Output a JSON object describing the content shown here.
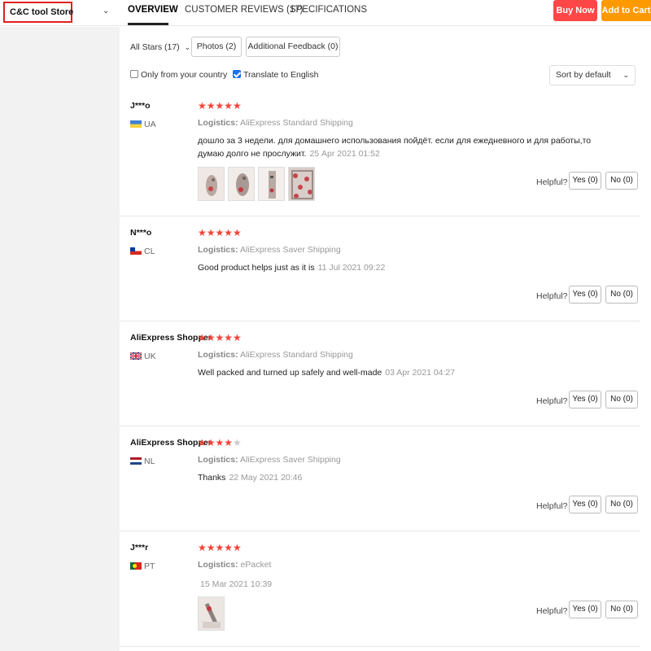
{
  "header": {
    "store_name": "C&C tool Store",
    "tabs": [
      "OVERVIEW",
      "CUSTOMER REVIEWS (17)",
      "SPECIFICATIONS"
    ],
    "buy_now": "Buy Now",
    "add_to_cart": "Add to Cart",
    "colors": {
      "buy": "#ff4747",
      "cart": "#ff9900",
      "accent": "#e02020"
    }
  },
  "filters": {
    "stars_dropdown": "All Stars (17)",
    "photos": "Photos (2)",
    "additional": "Additional Feedback (0)",
    "only_country": "Only from your country",
    "only_country_checked": false,
    "translate": "Translate to English",
    "translate_checked": true,
    "sort": "Sort by default"
  },
  "helpful_label": "Helpful?",
  "reviews": [
    {
      "name": "J***o",
      "country": "UA",
      "flag": "flag-ua-icon",
      "stars": 5,
      "logistics_label": "Logistics:",
      "logistics": "AliExpress Standard Shipping",
      "text": "дошло за 3 недели. для домашнего использования пойдёт. если для ежедневного и для работы,то думаю долго не прослужит.",
      "date": "25 Apr 2021 01:52",
      "photos": 4,
      "yes": "Yes (0)",
      "no": "No (0)"
    },
    {
      "name": "N***o",
      "country": "CL",
      "flag": "flag-cl-icon",
      "stars": 5,
      "logistics_label": "Logistics:",
      "logistics": "AliExpress Saver Shipping",
      "text": "Good product helps just as it is",
      "date": "11 Jul 2021 09:22",
      "photos": 0,
      "yes": "Yes (0)",
      "no": "No (0)"
    },
    {
      "name": "AliExpress Shopper",
      "country": "UK",
      "flag": "flag-uk-icon",
      "stars": 5,
      "logistics_label": "Logistics:",
      "logistics": "AliExpress Standard Shipping",
      "text": "Well packed and turned up safely and well-made",
      "date": "03 Apr 2021 04:27",
      "photos": 0,
      "yes": "Yes (0)",
      "no": "No (0)"
    },
    {
      "name": "AliExpress Shopper",
      "country": "NL",
      "flag": "flag-nl-icon",
      "stars": 4,
      "logistics_label": "Logistics:",
      "logistics": "AliExpress Saver Shipping",
      "text": "Thanks",
      "date": "22 May 2021 20:46",
      "photos": 0,
      "yes": "Yes (0)",
      "no": "No (0)"
    },
    {
      "name": "J***r",
      "country": "PT",
      "flag": "flag-pt-icon",
      "stars": 5,
      "logistics_label": "Logistics:",
      "logistics": "ePacket",
      "text": "",
      "date": "15 Mar 2021 10:39",
      "photos": 1,
      "yes": "Yes (0)",
      "no": "No (0)"
    }
  ]
}
